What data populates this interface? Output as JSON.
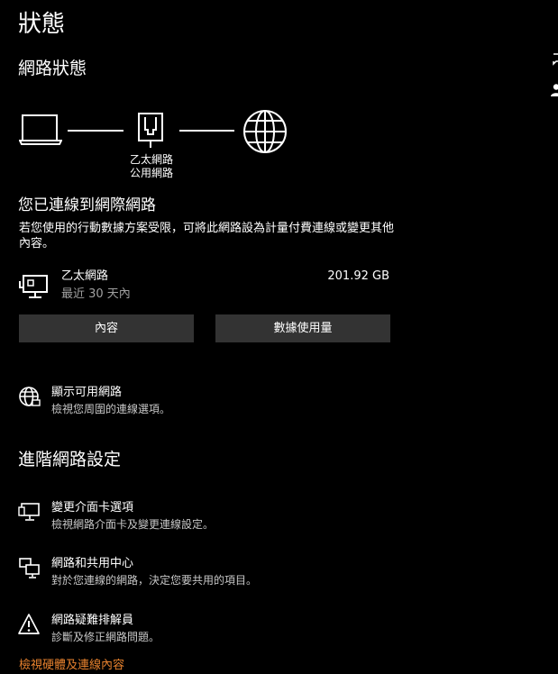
{
  "page": {
    "title": "狀態"
  },
  "network_status": {
    "heading": "網路狀態",
    "diagram": {
      "caption_line1": "乙太網路",
      "caption_line2": "公用網路"
    },
    "connected_title": "您已連線到網際網路",
    "connected_desc": "若您使用的行動數據方案受限，可將此網路設為計量付費連線或變更其他內容。"
  },
  "adapter": {
    "name": "乙太網路",
    "period": "最近 30 天內",
    "usage": "201.92 GB",
    "properties_button": "內容",
    "data_usage_button": "數據使用量"
  },
  "show_networks": {
    "title": "顯示可用網路",
    "desc": "檢視您周圍的連線選項。"
  },
  "advanced": {
    "heading": "進階網路設定",
    "items": [
      {
        "title": "變更介面卡選項",
        "desc": "檢視網路介面卡及變更連線設定。"
      },
      {
        "title": "網路和共用中心",
        "desc": "對於您連線的網路，決定您要共用的項目。"
      },
      {
        "title": "網路疑難排解員",
        "desc": "診斷及修正網路問題。"
      }
    ],
    "hardware_link": "檢視硬體及連線內容"
  },
  "icons": {
    "laptop": "laptop-icon",
    "ethernet": "ethernet-port-icon",
    "globe": "globe-icon",
    "adapter": "wired-network-icon",
    "show_networks": "network-globe-icon",
    "adapter_options": "adapter-options-icon",
    "sharing_center": "sharing-center-icon",
    "troubleshooter": "warning-icon",
    "side_chat": "chat-icon",
    "side_person": "person-icon"
  },
  "colors": {
    "background": "#000000",
    "text": "#ffffff",
    "secondary_text": "#a0a0a0",
    "button": "#333333",
    "link": "#e8822e"
  }
}
